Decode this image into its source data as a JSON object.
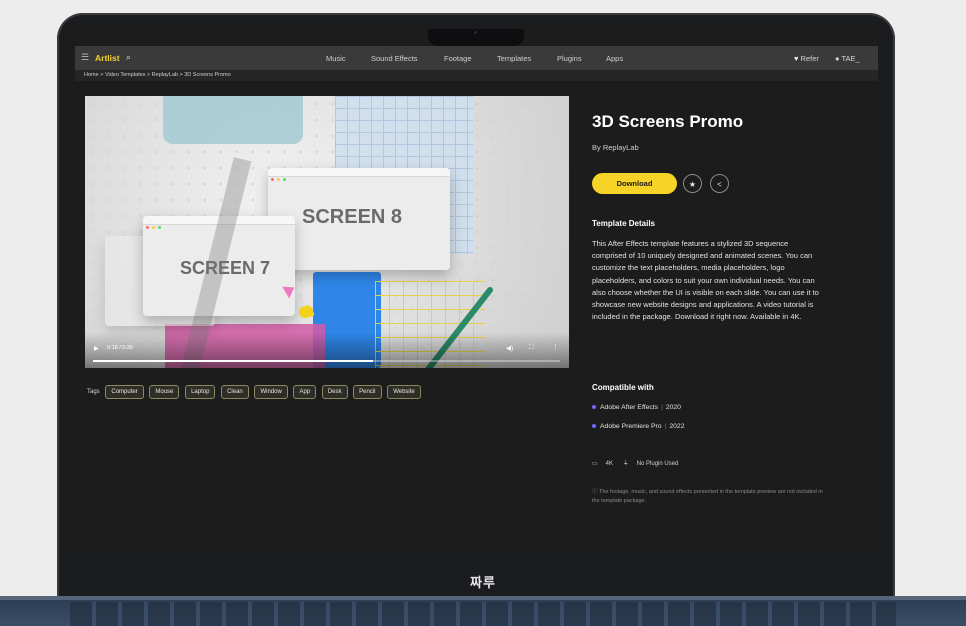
{
  "device": {
    "chin_label": "짜루"
  },
  "topbar": {
    "logo": "Artlist",
    "nav": [
      "Music",
      "Sound Effects",
      "Footage",
      "Templates",
      "Plugins",
      "Apps"
    ],
    "refer_label": "Refer",
    "user_label": "TAE_"
  },
  "breadcrumb": "Home  >  Video Templates  >  ReplayLab  >  3D Screens Promo",
  "video": {
    "screen_label_1": "SCREEN 8",
    "screen_label_2": "SCREEN 7",
    "time": "0:18 / 0:30",
    "progress": 0.6
  },
  "tags": {
    "label": "Tags",
    "items": [
      "Computer",
      "Mouse",
      "Laptop",
      "Clean",
      "Window",
      "App",
      "Desk",
      "Pencil",
      "Website"
    ]
  },
  "template": {
    "title": "3D Screens Promo",
    "by": "By ReplayLab",
    "download_label": "Download",
    "details_heading": "Template Details",
    "description": "This After Effects template features a stylized 3D sequence comprised of 10 uniquely designed and animated scenes. You can customize the text placeholders, media placeholders, logo placeholders, and colors to suit your own individual needs. You can also choose whether the UI is visible on each slide. You can use it to showcase new website designs and applications. A video tutorial is included in the package. Download it right now. Available in 4K.",
    "compatible_heading": "Compatible with",
    "compatible": [
      {
        "app": "Adobe After Effects",
        "year": "2020"
      },
      {
        "app": "Adobe Premiere Pro",
        "year": "2022"
      }
    ],
    "resolution": "4K",
    "plugin": "No Plugin Used",
    "disclaimer": "The footage, music, and sound effects presented in the template preview are not included in the template package."
  }
}
